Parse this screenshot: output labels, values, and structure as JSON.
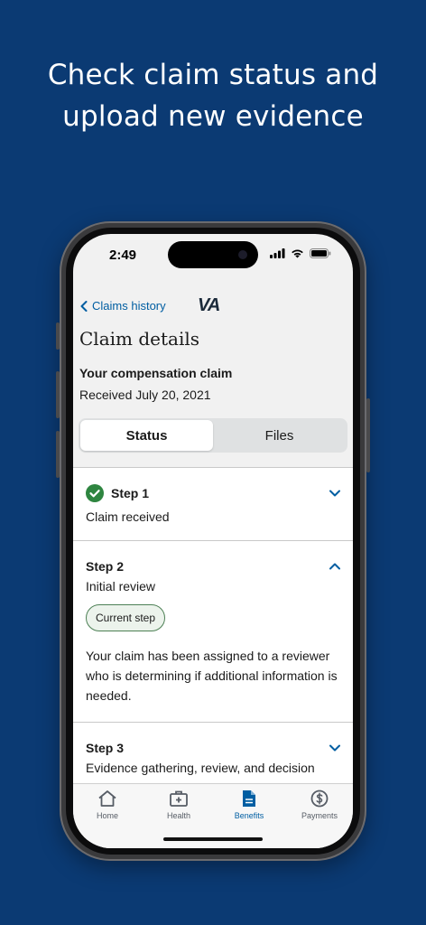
{
  "headline": {
    "line1": "Check claim status and",
    "line2": "upload new evidence"
  },
  "status_bar": {
    "time": "2:49",
    "icons": [
      "signal-icon",
      "wifi-icon",
      "battery-icon"
    ]
  },
  "nav": {
    "back_label": "Claims history",
    "logo": "VA"
  },
  "page_title": "Claim details",
  "claim": {
    "title": "Your compensation claim",
    "received": "Received July 20, 2021"
  },
  "segments": {
    "status": "Status",
    "files": "Files",
    "selected": "Status"
  },
  "steps": [
    {
      "title": "Step 1",
      "subtitle": "Claim received",
      "completed": true,
      "expanded": false
    },
    {
      "title": "Step 2",
      "subtitle": "Initial review",
      "badge": "Current step",
      "body": "Your claim has been assigned to a reviewer who is determining if additional information is needed.",
      "expanded": true
    },
    {
      "title": "Step 3",
      "subtitle": "Evidence gathering, review, and decision",
      "expanded": false
    }
  ],
  "tabbar": {
    "home": "Home",
    "health": "Health",
    "benefits": "Benefits",
    "payments": "Payments",
    "active": "Benefits"
  },
  "colors": {
    "background": "#0b3a73",
    "link": "#005ea2",
    "success": "#2e8540",
    "badge_bg": "#ecf3ec",
    "badge_border": "#4d8055"
  }
}
